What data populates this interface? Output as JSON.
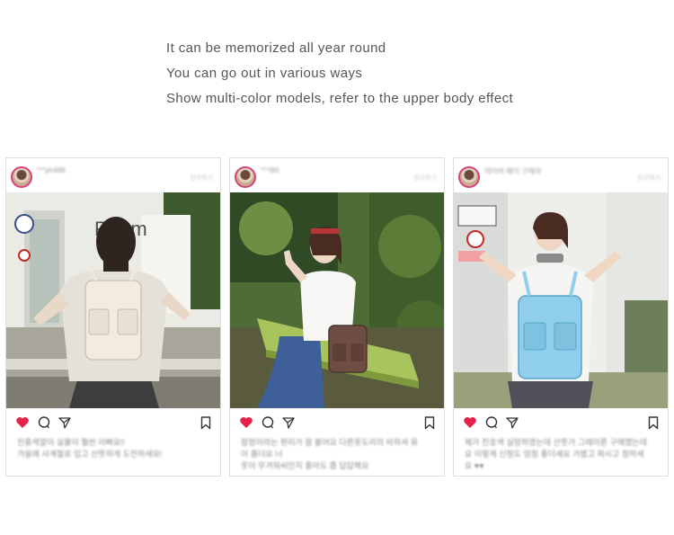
{
  "intro": {
    "lines": [
      "It can be memorized all year round",
      "You can go out in various ways",
      "Show multi-color models, refer to the upper body effect"
    ]
  },
  "colors": {
    "heart": "#e8204a",
    "icon_stroke": "#333333",
    "card_border": "#dedede",
    "text": "#555555"
  },
  "posts": [
    {
      "username": "***ph488",
      "action": "친구하기",
      "caption": [
        "진흥색깔이 실물이 훨씬 이뻐요!!",
        "가을에 사계절로 입고 산뜻하게 도전하세요!"
      ],
      "photo_subject": "cream-backpack-back-view",
      "bag_color": "#ece4d8"
    },
    {
      "username": "***ðlß",
      "action": "친구하기",
      "caption": [
        "잠정이라는 편리가 잘 붙어요 다른옷도리의 비하셔 유",
        "이 품더요 너",
        "옷이 무겨워씨안지 좋아도 좀 답답해요"
      ],
      "photo_subject": "brown-backpack-sitting-bench",
      "bag_color": "#6e4e44"
    },
    {
      "username": "데이버 패이 구매자",
      "action": "친구하기",
      "caption": [
        "제가 친호색 실망하였는데 산뜻가 그레이론 구매했는데",
        "요 이렇게 신청도 엄청 좋더세요 가볍고 파시고 정하세",
        "요 ♥♥"
      ],
      "photo_subject": "blue-backpack-front-view",
      "bag_color": "#8fcfec"
    }
  ]
}
